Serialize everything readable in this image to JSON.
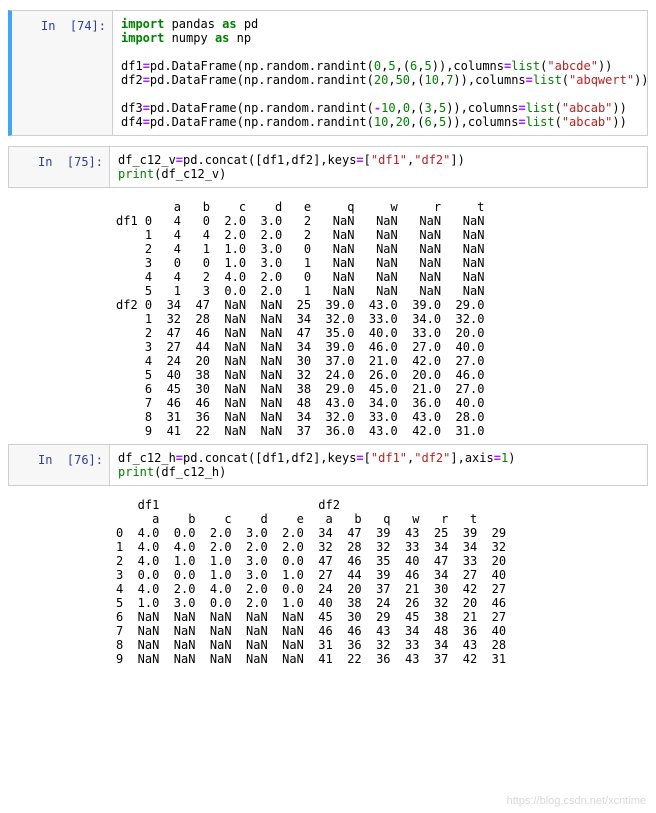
{
  "cells": [
    {
      "prompt": "In  [74]:",
      "code_html": "<span class='k'>import</span> pandas <span class='k'>as</span> pd\n<span class='k'>import</span> numpy <span class='k'>as</span> np\n\ndf1<span class='op'>=</span>pd.DataFrame(np.random.randint(<span class='num'>0</span>,<span class='num'>5</span>,(<span class='num'>6</span>,<span class='num'>5</span>)),columns<span class='op'>=</span><span class='builtin'>list</span>(<span class='str'>\"abcde\"</span>))\ndf2<span class='op'>=</span>pd.DataFrame(np.random.randint(<span class='num'>20</span>,<span class='num'>50</span>,(<span class='num'>10</span>,<span class='num'>7</span>)),columns<span class='op'>=</span><span class='builtin'>list</span>(<span class='str'>\"abqwert\"</span>))\n\ndf3<span class='op'>=</span>pd.DataFrame(np.random.randint(<span class='op'>-</span><span class='num'>10</span>,<span class='num'>0</span>,(<span class='num'>3</span>,<span class='num'>5</span>)),columns<span class='op'>=</span><span class='builtin'>list</span>(<span class='str'>\"abcab\"</span>))\ndf4<span class='op'>=</span>pd.DataFrame(np.random.randint(<span class='num'>10</span>,<span class='num'>20</span>,(<span class='num'>6</span>,<span class='num'>5</span>)),columns<span class='op'>=</span><span class='builtin'>list</span>(<span class='str'>\"abcab\"</span>))",
      "has_output": false,
      "accent": true
    },
    {
      "prompt": "In  [75]:",
      "code_html": "df_c12_v<span class='op'>=</span>pd.concat([df1,df2],keys<span class='op'>=</span>[<span class='str'>\"df1\"</span>,<span class='str'>\"df2\"</span>])\n<span class='pyprint'>print</span>(df_c12_v)",
      "has_output": true,
      "output": "        a   b    c    d   e     q     w     r     t\ndf1 0   4   0  2.0  3.0   2   NaN   NaN   NaN   NaN\n    1   4   4  2.0  2.0   2   NaN   NaN   NaN   NaN\n    2   4   1  1.0  3.0   0   NaN   NaN   NaN   NaN\n    3   0   0  1.0  3.0   1   NaN   NaN   NaN   NaN\n    4   4   2  4.0  2.0   0   NaN   NaN   NaN   NaN\n    5   1   3  0.0  2.0   1   NaN   NaN   NaN   NaN\ndf2 0  34  47  NaN  NaN  25  39.0  43.0  39.0  29.0\n    1  32  28  NaN  NaN  34  32.0  33.0  34.0  32.0\n    2  47  46  NaN  NaN  47  35.0  40.0  33.0  20.0\n    3  27  44  NaN  NaN  34  39.0  46.0  27.0  40.0\n    4  24  20  NaN  NaN  30  37.0  21.0  42.0  27.0\n    5  40  38  NaN  NaN  32  24.0  26.0  20.0  46.0\n    6  45  30  NaN  NaN  38  29.0  45.0  21.0  27.0\n    7  46  46  NaN  NaN  48  43.0  34.0  36.0  40.0\n    8  31  36  NaN  NaN  34  32.0  33.0  43.0  28.0\n    9  41  22  NaN  NaN  37  36.0  43.0  42.0  31.0",
      "accent": false
    },
    {
      "prompt": "In  [76]:",
      "code_html": "df_c12_h<span class='op'>=</span>pd.concat([df1,df2],keys<span class='op'>=</span>[<span class='str'>\"df1\"</span>,<span class='str'>\"df2\"</span>],axis<span class='op'>=</span><span class='num'>1</span>)\n<span class='pyprint'>print</span>(df_c12_h)",
      "has_output": true,
      "output": "   df1                      df2                        \n     a    b    c    d    e   a   b   q   w   r   t\n0  4.0  0.0  2.0  3.0  2.0  34  47  39  43  25  39  29\n1  4.0  4.0  2.0  2.0  2.0  32  28  32  33  34  34  32\n2  4.0  1.0  1.0  3.0  0.0  47  46  35  40  47  33  20\n3  0.0  0.0  1.0  3.0  1.0  27  44  39  46  34  27  40\n4  4.0  2.0  4.0  2.0  0.0  24  20  37  21  30  42  27\n5  1.0  3.0  0.0  2.0  1.0  40  38  24  26  32  20  46\n6  NaN  NaN  NaN  NaN  NaN  45  30  29  45  38  21  27\n7  NaN  NaN  NaN  NaN  NaN  46  46  43  34  48  36  40\n8  NaN  NaN  NaN  NaN  NaN  31  36  32  33  34  43  28\n9  NaN  NaN  NaN  NaN  NaN  41  22  36  43  37  42  31",
      "accent": false
    }
  ],
  "watermark": "https://blog.csdn.net/xcntime"
}
